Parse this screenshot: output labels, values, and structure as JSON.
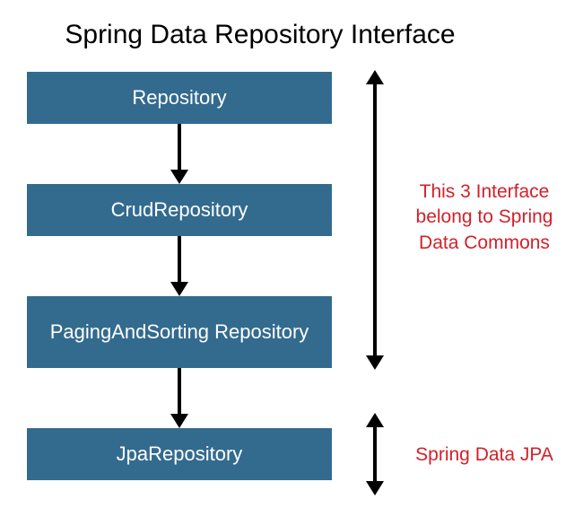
{
  "title": "Spring Data Repository Interface",
  "boxes": {
    "b1": "Repository",
    "b2": "CrudRepository",
    "b3": "PagingAndSorting Repository",
    "b4": "JpaRepository"
  },
  "annotations": {
    "a1": "This 3 Interface belong to Spring Data Commons",
    "a2": "Spring Data JPA"
  },
  "colors": {
    "boxFill": "#336b8f",
    "boxText": "#ffffff",
    "arrow": "#000000",
    "annotationText": "#d4202a"
  }
}
